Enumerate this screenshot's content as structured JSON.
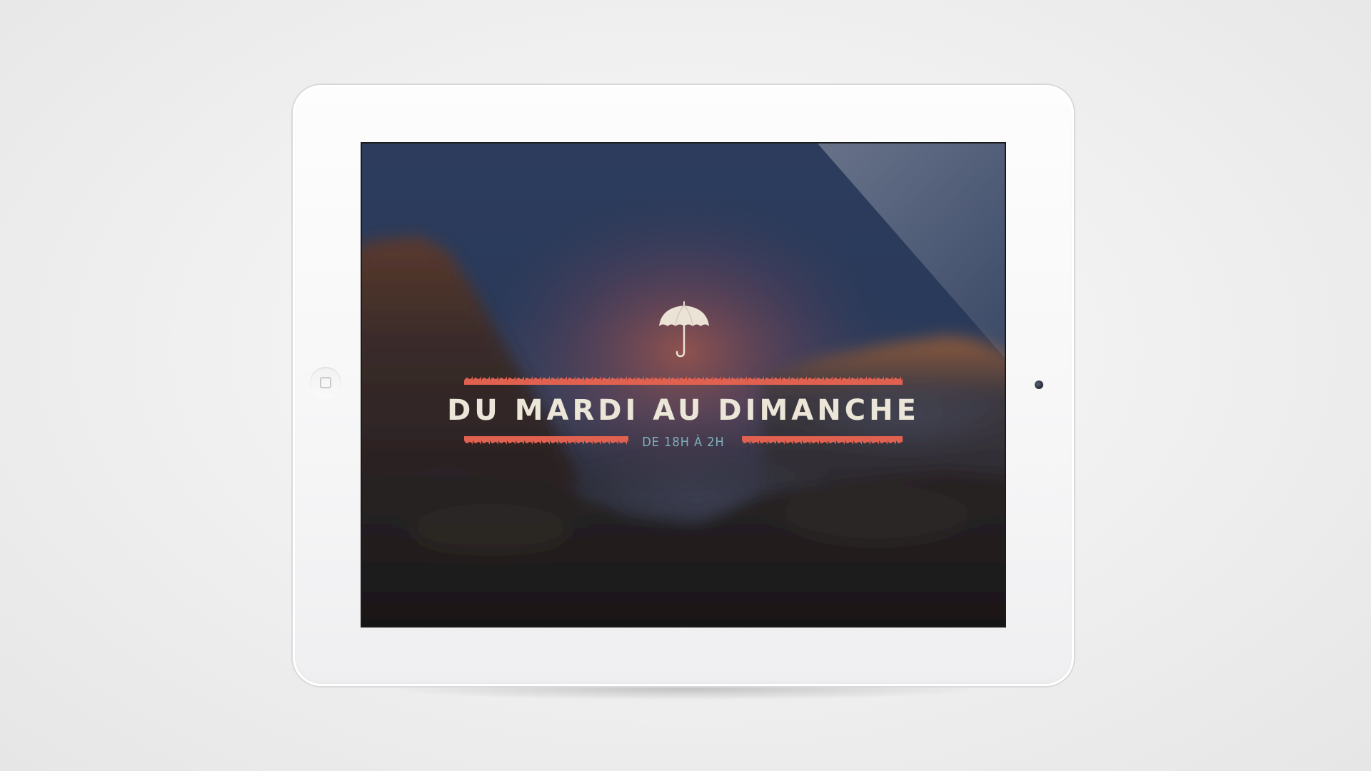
{
  "screen": {
    "headline": "DU MARDI AU DIMANCHE",
    "subline": "DE 18H À 2H"
  },
  "icons": {
    "hero": "umbrella-icon",
    "home": "home-button-icon"
  },
  "colors": {
    "accent_red": "#e0614f",
    "headline_cream": "#ece6d8",
    "subline_teal": "#7fb1bd",
    "bezel_white": "#f7f7f8",
    "sky_navy": "#2b3a58"
  }
}
